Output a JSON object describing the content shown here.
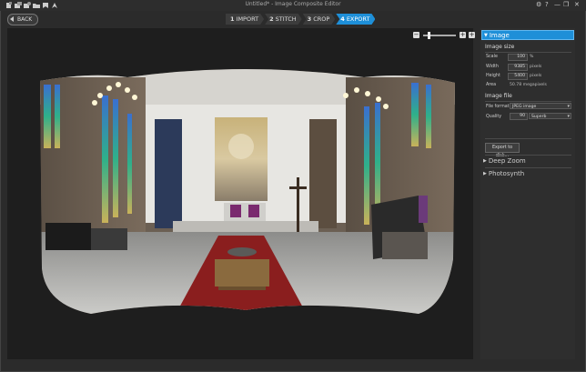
{
  "window": {
    "title": "Untitled* - Image Composite Editor",
    "help": "?",
    "settings_icon": "gear-icon",
    "minimize": "—",
    "maximize": "❐",
    "close": "✕"
  },
  "nav": {
    "back_label": "BACK"
  },
  "steps": [
    {
      "num": "1",
      "label": "IMPORT"
    },
    {
      "num": "2",
      "label": "STITCH"
    },
    {
      "num": "3",
      "label": "CROP"
    },
    {
      "num": "4",
      "label": "EXPORT"
    }
  ],
  "zoom": {
    "minus": "−",
    "plus": "+",
    "fit": "+",
    "level": 0.15
  },
  "panel": {
    "image_header": "Image",
    "image_size_label": "Image size",
    "scale_label": "Scale",
    "scale_value": "100",
    "scale_unit": "%",
    "width_label": "Width",
    "width_value": "9385",
    "width_unit": "pixels",
    "height_label": "Height",
    "height_value": "5400",
    "height_unit": "pixels",
    "area_label": "Area",
    "area_value": "50.78 megapixels",
    "image_file_label": "Image file",
    "file_format_label": "File format",
    "file_format_value": "JPEG image",
    "quality_label": "Quality",
    "quality_value": "90",
    "quality_option": "Superb",
    "export_button": "Export to disk...",
    "deep_zoom_header": "Deep Zoom",
    "photosynth_header": "Photosynth"
  },
  "colors": {
    "accent": "#1e8fd8",
    "background": "#2b2b2b",
    "canvas": "#1e1e1e"
  }
}
